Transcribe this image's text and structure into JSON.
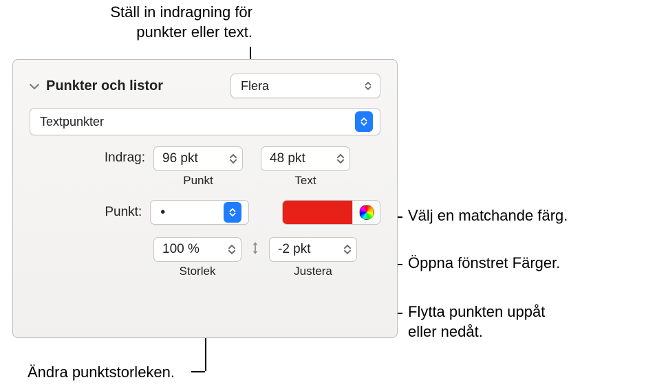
{
  "callouts": {
    "indent": "Ställ in indragning för\npunkter eller text.",
    "match_color": "Välj en matchande färg.",
    "open_colors": "Öppna fönstret Färger.",
    "move_bullet": "Flytta punkten uppåt\neller nedåt.",
    "change_size": "Ändra punktstorleken."
  },
  "section": {
    "title": "Punkter och listor",
    "style_value": "Flera"
  },
  "bullet_type_value": "Textpunkter",
  "indent": {
    "label": "Indrag:",
    "bullet_value": "96 pkt",
    "bullet_sublabel": "Punkt",
    "text_value": "48 pkt",
    "text_sublabel": "Text"
  },
  "bullet": {
    "label": "Punkt:",
    "glyph": "•",
    "color": "#e72118"
  },
  "size": {
    "value": "100 %",
    "sublabel": "Storlek"
  },
  "align": {
    "value": "-2 pkt",
    "sublabel": "Justera"
  }
}
